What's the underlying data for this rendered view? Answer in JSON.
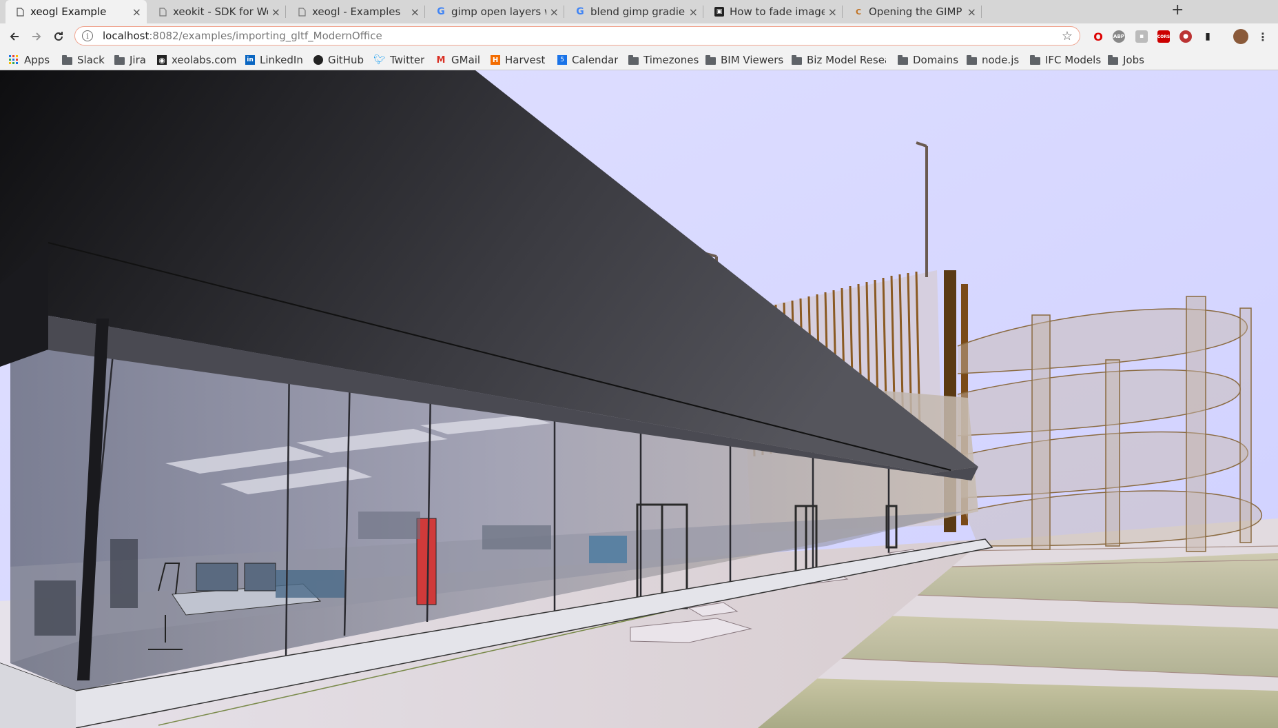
{
  "tabs": [
    {
      "title": "xeogl Example",
      "icon": "page-icon",
      "active": true
    },
    {
      "title": "xeokit - SDK for Web-Based",
      "icon": "page-icon",
      "active": false
    },
    {
      "title": "xeogl - Examples",
      "icon": "page-icon",
      "active": false
    },
    {
      "title": "gimp open layers window",
      "icon": "google-icon",
      "active": false
    },
    {
      "title": "blend gimp gradient layer",
      "icon": "google-icon",
      "active": false
    },
    {
      "title": "How to fade image layers",
      "icon": "site-icon",
      "active": false
    },
    {
      "title": "Opening the GIMP Layers",
      "icon": "site-icon",
      "active": false
    }
  ],
  "toolbar": {
    "url_host": "localhost",
    "url_path": ":8082/examples/importing_gltf_ModernOffice"
  },
  "bookmarks": [
    {
      "label": "Apps",
      "icon": "apps-grid-icon"
    },
    {
      "label": "Slack",
      "icon": "folder-icon"
    },
    {
      "label": "Jira",
      "icon": "folder-icon"
    },
    {
      "label": "xeolabs.com",
      "icon": "xeolabs-icon"
    },
    {
      "label": "LinkedIn",
      "icon": "linkedin-icon"
    },
    {
      "label": "GitHub",
      "icon": "github-icon"
    },
    {
      "label": "Twitter",
      "icon": "twitter-icon"
    },
    {
      "label": "GMail",
      "icon": "gmail-icon"
    },
    {
      "label": "Harvest",
      "icon": "harvest-icon"
    },
    {
      "label": "Calendar",
      "icon": "calendar-icon"
    },
    {
      "label": "Timezones",
      "icon": "folder-icon"
    },
    {
      "label": "BIM Viewers",
      "icon": "folder-icon"
    },
    {
      "label": "Biz Model Research",
      "icon": "folder-icon"
    },
    {
      "label": "Domains",
      "icon": "folder-icon"
    },
    {
      "label": "node.js",
      "icon": "folder-icon"
    },
    {
      "label": "IFC Models",
      "icon": "folder-icon"
    },
    {
      "label": "Jobs",
      "icon": "folder-icon"
    }
  ],
  "colors": {
    "sky": "#dcdcff",
    "roof": "#3a3a3e",
    "wood": "#8a5a22",
    "ground": "#e8e0e6",
    "grass": "#b8b890"
  }
}
